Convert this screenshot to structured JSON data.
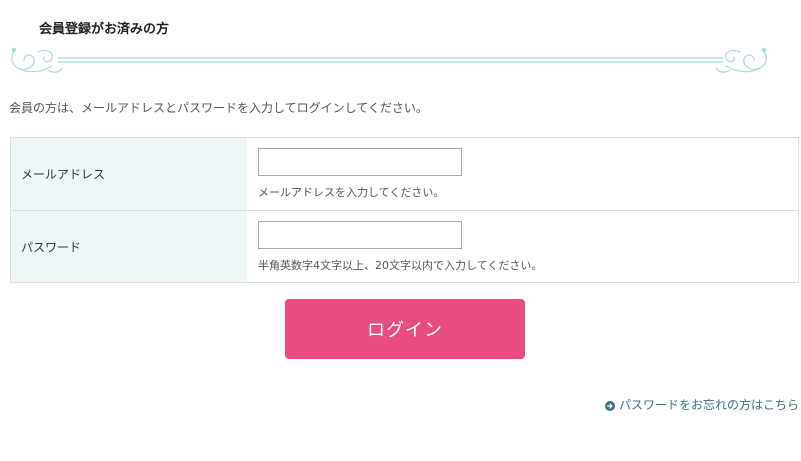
{
  "section": {
    "title": "会員登録がお済みの方"
  },
  "intro_text": "会員の方は、メールアドレスとパスワードを入力してログインしてください。",
  "form": {
    "email": {
      "label": "メールアドレス",
      "value": "",
      "placeholder": "",
      "hint": "メールアドレスを入力してください。"
    },
    "password": {
      "label": "パスワード",
      "value": "",
      "placeholder": "",
      "hint": "半角英数字4文字以上、20文字以内で入力してください。"
    }
  },
  "login_button": {
    "label": "ログイン"
  },
  "forgot_link": {
    "label": "パスワードをお忘れの方はこちら",
    "icon": "circle-arrow-right-icon"
  },
  "colors": {
    "accent": "#e84c83",
    "label_bg": "#eef6f8",
    "link": "#3d6f85",
    "ornament": "#a8d8e4"
  }
}
